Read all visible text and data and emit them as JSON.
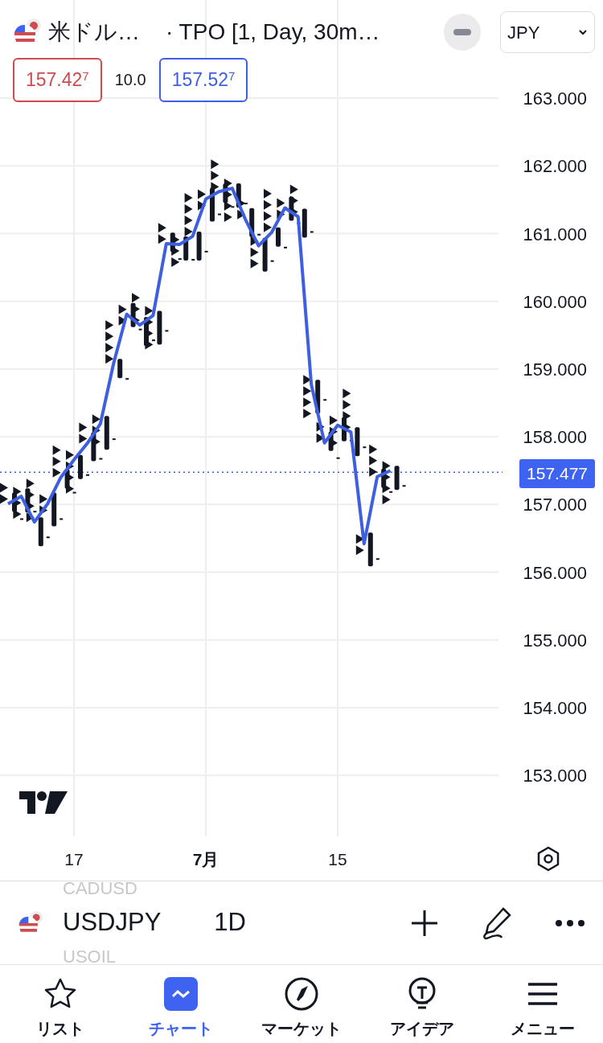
{
  "header": {
    "symbol": "米ドル…",
    "study": "· TPO [1, Day, 30m…",
    "currency": "JPY"
  },
  "quotes": {
    "sell": "157.42$^{7}$",
    "spread": "10.0",
    "buy": "157.52$^{7}$"
  },
  "chart": {
    "last_price": "157.477",
    "chart_data": {
      "type": "line",
      "categories": [
        null,
        null,
        null,
        null,
        null,
        "17",
        null,
        null,
        null,
        null,
        null,
        null,
        null,
        null,
        null,
        "7月",
        null,
        null,
        null,
        null,
        null,
        null,
        null,
        null,
        null,
        "15",
        null,
        null,
        null,
        null
      ],
      "series": [
        {
          "color": "#3d5fe0",
          "values": [
            157.01,
            157.12,
            156.74,
            157.01,
            157.4,
            157.66,
            157.9,
            158.19,
            159.08,
            159.81,
            159.65,
            159.79,
            160.85,
            160.84,
            160.96,
            161.51,
            161.62,
            161.67,
            161.21,
            160.82,
            161.02,
            161.38,
            161.25,
            158.77,
            157.91,
            158.17,
            158.07,
            156.42,
            157.41,
            157.5
          ]
        }
      ],
      "ylim": [
        152.04,
        164.45
      ],
      "grid": true,
      "ref_lines": [
        {
          "axis": "y",
          "value": 157.477,
          "color": "#3d5fe0"
        }
      ],
      "yticks": [
        {
          "value": 163,
          "label": "163.000"
        },
        {
          "value": 162,
          "label": "162.000"
        },
        {
          "value": 161,
          "label": "161.000"
        },
        {
          "value": 160,
          "label": "160.000"
        },
        {
          "value": 159,
          "label": "159.000"
        },
        {
          "value": 158,
          "label": "158.000"
        },
        {
          "value": 157,
          "label": "157.000"
        },
        {
          "value": 156,
          "label": "156.000"
        },
        {
          "value": 155,
          "label": "155.000"
        },
        {
          "value": 154,
          "label": "154.000"
        },
        {
          "value": 153,
          "label": "153.000"
        }
      ]
    }
  },
  "symbol_bar": {
    "prev": "CADUSD",
    "symbol": "USDJPY",
    "interval": "1D",
    "next": "USOIL"
  },
  "tabs": [
    {
      "label": "リスト",
      "selected": false
    },
    {
      "label": "チャート",
      "selected": true
    },
    {
      "label": "マーケット",
      "selected": false
    },
    {
      "label": "アイデア",
      "selected": false
    },
    {
      "label": "メニュー",
      "selected": false
    }
  ]
}
